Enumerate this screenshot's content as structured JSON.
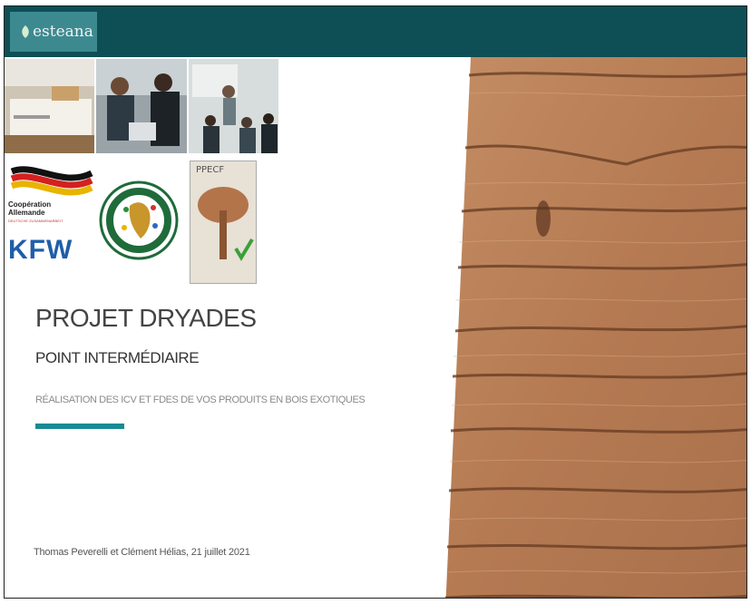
{
  "header": {
    "logo_text": "esteana"
  },
  "logos": {
    "coop_label_line1": "Coopération",
    "coop_label_line2": "Allemande",
    "coop_sub": "DEUTSCHE ZUSAMMENARBEIT",
    "kfw": "KFW",
    "comifac_ring": "COMMISSION DES FORETS D'AFRIQUE CENTRALE",
    "comifac_name": "COMIFAC",
    "ppecp": "PPECF"
  },
  "slide": {
    "title": "PROJET DRYADES",
    "subtitle": "POINT INTERMÉDIAIRE",
    "tagline": "RÉALISATION  DES ICV ET FDES DE  VOS PRODUITS EN BOIS EXOTIQUES",
    "byline": "Thomas Peverelli et Clément Hélias, 21 juillet 2021"
  },
  "colors": {
    "topbar": "#0e4f55",
    "logo_box": "#3c8a90",
    "accent": "#188b95",
    "kfw_blue": "#1f5ea8"
  }
}
